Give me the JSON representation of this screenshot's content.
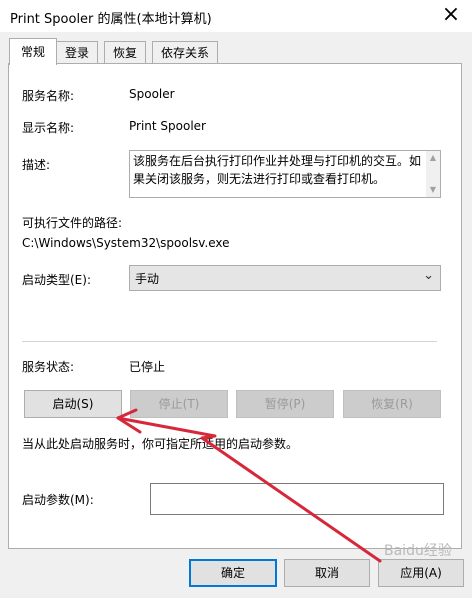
{
  "window": {
    "title": "Print Spooler 的属性(本地计算机)",
    "close_glyph": "×"
  },
  "tabs": [
    {
      "label": "常规",
      "active": true
    },
    {
      "label": "登录",
      "active": false
    },
    {
      "label": "恢复",
      "active": false
    },
    {
      "label": "依存关系",
      "active": false
    }
  ],
  "general": {
    "service_name_label": "服务名称:",
    "service_name": "Spooler",
    "display_name_label": "显示名称:",
    "display_name": "Print Spooler",
    "description_label": "描述:",
    "description": "该服务在后台执行打印作业并处理与打印机的交互。如果关闭该服务，则无法进行打印或查看打印机。",
    "exe_path_label": "可执行文件的路径:",
    "exe_path": "C:\\Windows\\System32\\spoolsv.exe",
    "startup_type_label": "启动类型(E):",
    "startup_type": "手动",
    "status_label": "服务状态:",
    "status": "已停止",
    "buttons": {
      "start": "启动(S)",
      "stop": "停止(T)",
      "pause": "暂停(P)",
      "resume": "恢复(R)"
    },
    "hint": "当从此处启动服务时，你可指定所适用的启动参数。",
    "params_label": "启动参数(M):",
    "params_value": ""
  },
  "footer": {
    "ok": "确定",
    "cancel": "取消",
    "apply": "应用(A)"
  },
  "watermark": "Baidu经验",
  "colors": {
    "annotation_arrow": "#d6283a",
    "focus_border": "#0078d7"
  }
}
